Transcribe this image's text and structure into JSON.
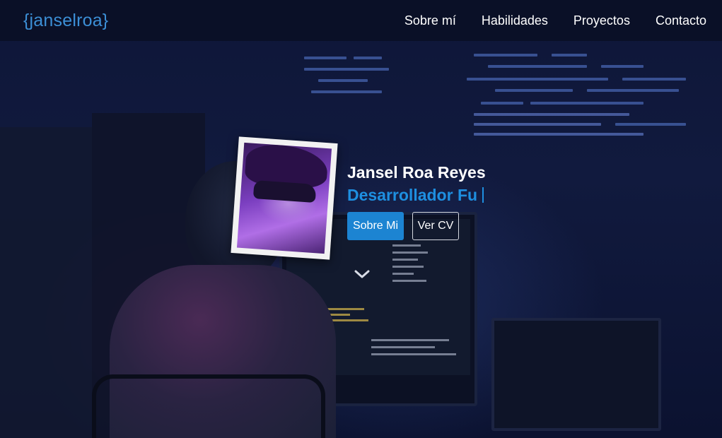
{
  "navbar": {
    "brand": "{janselroa}",
    "links": [
      {
        "label": "Sobre mí"
      },
      {
        "label": "Habilidades"
      },
      {
        "label": "Proyectos"
      },
      {
        "label": "Contacto"
      }
    ]
  },
  "hero": {
    "name": "Jansel Roa Reyes",
    "role_typed": "Desarrollador Fu",
    "buttons": {
      "about_label": "Sobre Mi",
      "cv_label": "Ver CV"
    },
    "scroll_icon": "chevron-down-icon"
  },
  "colors": {
    "brand": "#3c8fd6",
    "accent": "#1e8fe0",
    "navbar_bg": "#0a1026"
  }
}
